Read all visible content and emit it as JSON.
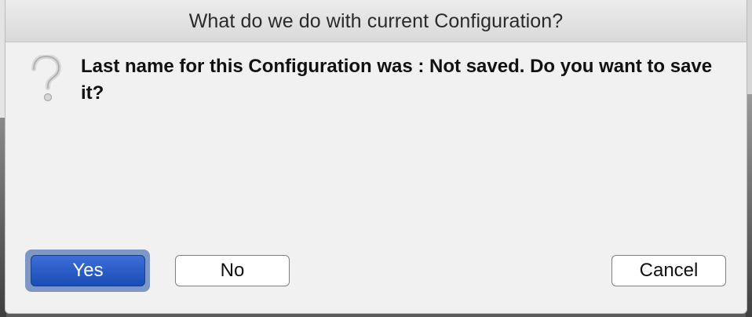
{
  "dialog": {
    "title": "What do we do with current Configuration?",
    "icon": "question-mark-icon",
    "message": "Last name for this Configuration was : Not saved. Do you want to save it?",
    "buttons": {
      "yes": "Yes",
      "no": "No",
      "cancel": "Cancel"
    }
  },
  "colors": {
    "default_button": "#2457c5",
    "dialog_background": "#f1f1f1"
  }
}
